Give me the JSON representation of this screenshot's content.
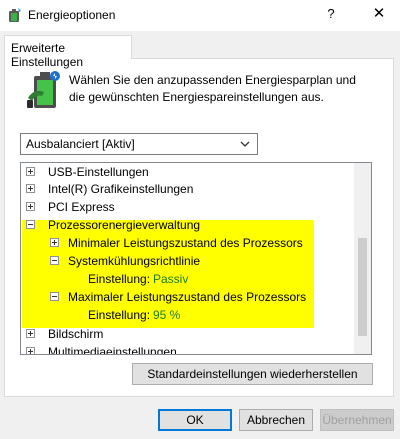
{
  "window": {
    "title": "Energieoptionen",
    "help_label": "?",
    "close_label": "✕"
  },
  "tabs": [
    {
      "label": "Erweiterte Einstellungen"
    }
  ],
  "description": "Wählen Sie den anzupassenden Energiesparplan und die gewünschten Energiespareinstellungen aus.",
  "plan_select": {
    "value": "Ausbalanciert [Aktiv]"
  },
  "tree": {
    "items": [
      {
        "label": "USB-Einstellungen"
      },
      {
        "label": "Intel(R) Grafikeinstellungen"
      },
      {
        "label": "PCI Express"
      },
      {
        "label": "Prozessorenergieverwaltung"
      },
      {
        "label": "Minimaler Leistungszustand des Prozessors"
      },
      {
        "label": "Systemkühlungsrichtlinie"
      },
      {
        "label": "Einstellung:",
        "value": "Passiv"
      },
      {
        "label": "Maximaler Leistungszustand des Prozessors"
      },
      {
        "label": "Einstellung:",
        "value": "95 %"
      },
      {
        "label": "Bildschirm"
      },
      {
        "label": "Multimediaeinstellungen"
      }
    ]
  },
  "buttons": {
    "restore_defaults": "Standardeinstellungen wiederherstellen",
    "ok": "OK",
    "cancel": "Abbrechen",
    "apply": "Übernehmen"
  },
  "colors": {
    "highlight": "#ffff00",
    "setting_value": "#1e7a1e",
    "accent": "#0078d7"
  }
}
